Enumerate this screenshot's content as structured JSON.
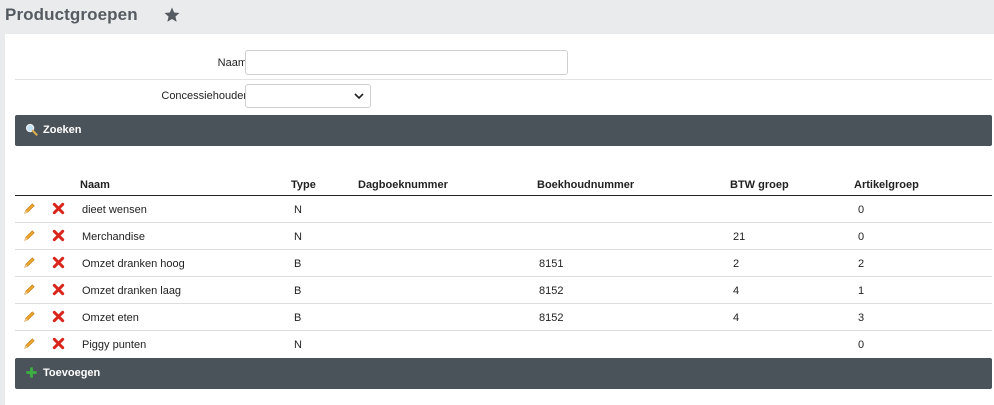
{
  "header": {
    "title": "Productgroepen",
    "favorite_icon": "star-icon"
  },
  "search_form": {
    "naam_label": "Naam",
    "naam_value": "",
    "concessiehouder_label": "Concessiehouder",
    "concessiehouder_value": "",
    "search_button_label": "Zoeken",
    "search_icon": "magnifier-icon"
  },
  "table": {
    "columns": [
      "Naam",
      "Type",
      "Dagboeknummer",
      "Boekhoudnummer",
      "BTW groep",
      "Artikelgroep"
    ],
    "rows": [
      {
        "naam": "dieet wensen",
        "type": "N",
        "dagboeknummer": "",
        "boekhoudnummer": "",
        "btw_groep": "",
        "artikelgroep": "0"
      },
      {
        "naam": "Merchandise",
        "type": "N",
        "dagboeknummer": "",
        "boekhoudnummer": "",
        "btw_groep": "21",
        "artikelgroep": "0"
      },
      {
        "naam": "Omzet dranken hoog",
        "type": "B",
        "dagboeknummer": "",
        "boekhoudnummer": "8151",
        "btw_groep": "2",
        "artikelgroep": "2"
      },
      {
        "naam": "Omzet dranken laag",
        "type": "B",
        "dagboeknummer": "",
        "boekhoudnummer": "8152",
        "btw_groep": "4",
        "artikelgroep": "1"
      },
      {
        "naam": "Omzet eten",
        "type": "B",
        "dagboeknummer": "",
        "boekhoudnummer": "8152",
        "btw_groep": "4",
        "artikelgroep": "3"
      },
      {
        "naam": "Piggy punten",
        "type": "N",
        "dagboeknummer": "",
        "boekhoudnummer": "",
        "btw_groep": "",
        "artikelgroep": "0"
      }
    ]
  },
  "add_bar": {
    "label": "Toevoegen",
    "icon": "plus-icon"
  },
  "colors": {
    "bar_background": "#4b535a",
    "header_background": "#e9ebed",
    "title_color": "#555b61",
    "edit_icon": "#e8a030",
    "delete_icon": "#d9261c",
    "add_icon": "#3cb043"
  }
}
